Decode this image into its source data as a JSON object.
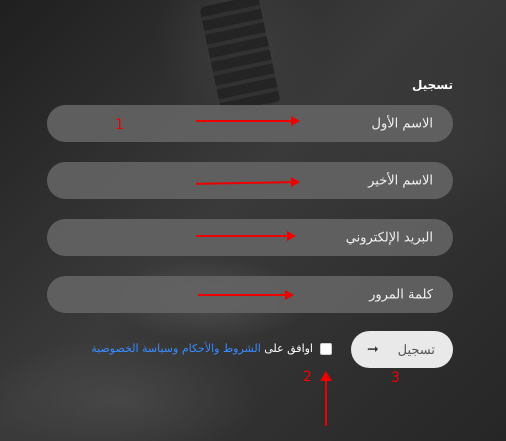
{
  "form": {
    "title": "تسجيل",
    "first_name_placeholder": "الاسم الأول",
    "last_name_placeholder": "الاسم الأخير",
    "email_placeholder": "البريد الإلكتروني",
    "password_placeholder": "كلمة المرور",
    "agree_text": "اوافق على",
    "terms_link": "الشروط والأحكام وسياسة الخصوصية",
    "submit_label": "تسجيل",
    "submit_arrow": "➞"
  },
  "annotations": {
    "label_1": "1",
    "label_2": "2",
    "label_3": "3",
    "color": "#e00000"
  },
  "colors": {
    "field_bg": "#646464",
    "link": "#3a8bff",
    "button_bg": "#e9e9e9"
  }
}
